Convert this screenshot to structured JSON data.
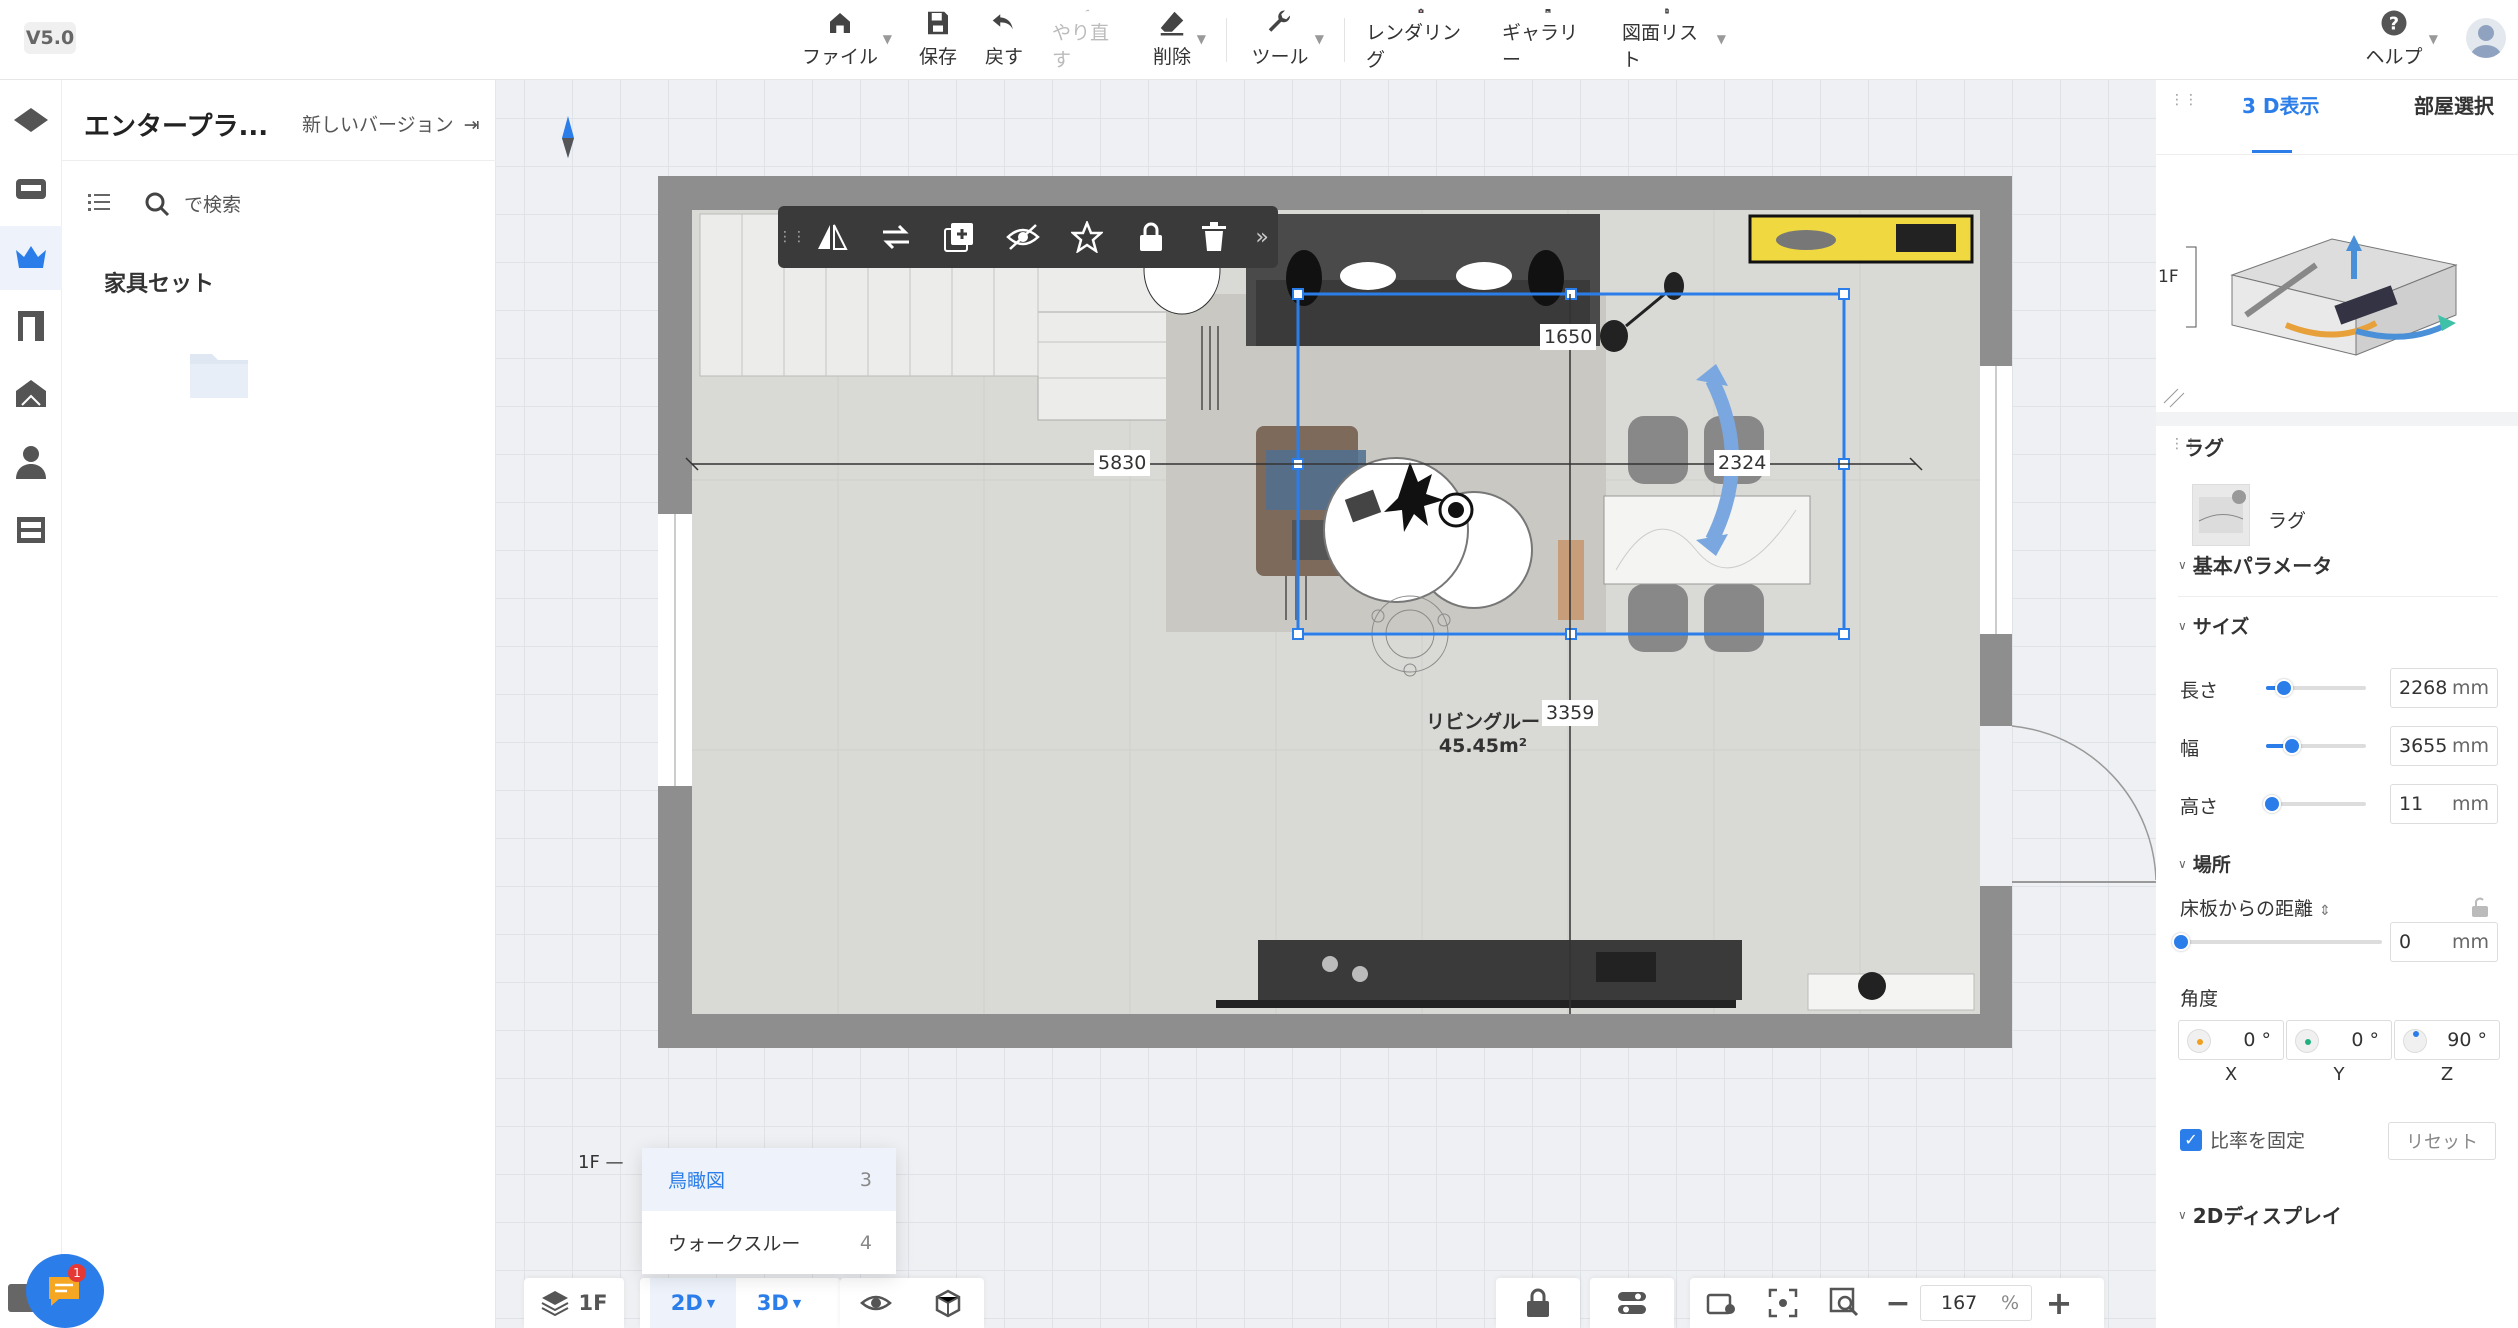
{
  "version": "V5.0",
  "toolbar": {
    "file": "ファイル",
    "save": "保存",
    "undo": "戻す",
    "redo": "やり直す",
    "delete": "削除",
    "tools": "ツール",
    "rendering": "レンダリング",
    "gallery": "ギャラリー",
    "drawing_list": "図面リスト",
    "help": "ヘルプ"
  },
  "left_panel": {
    "title": "エンタープラ...",
    "new_version": "新しいバージョン",
    "search_placeholder": "で検索",
    "category": "家具セット"
  },
  "canvas": {
    "room_name": "リビングルー",
    "room_area": "45.45m²",
    "dim_width": "5830",
    "dim_top": "1650",
    "dim_right": "2324",
    "dim_bottom": "3359",
    "floor_marker": "1F"
  },
  "view_menu": {
    "items": [
      {
        "label": "鳥瞰図",
        "count": "3"
      },
      {
        "label": "ウォークスルー",
        "count": "4"
      }
    ]
  },
  "bottom_left": {
    "floor": "1F",
    "mode_2d": "2D",
    "mode_3d": "3D"
  },
  "bottom_right": {
    "zoom": "167",
    "zoom_unit": "%"
  },
  "right_panel": {
    "tab_3d": "3 D表示",
    "tab_room": "部屋選択",
    "preview_floor": "1F",
    "object_title": "ラグ",
    "object_name": "ラグ",
    "section_basic": "基本パラメータ",
    "section_size": "サイズ",
    "length_label": "長さ",
    "length_value": "2268",
    "width_label": "幅",
    "width_value": "3655",
    "height_label": "高さ",
    "height_value": "11",
    "unit": "mm",
    "section_location": "場所",
    "floor_distance_label": "床板からの距離",
    "floor_distance_value": "0",
    "angle_label": "角度",
    "angle_x": "0",
    "angle_y": "0",
    "angle_z": "90",
    "degree": "°",
    "axis_x": "X",
    "axis_y": "Y",
    "axis_z": "Z",
    "lock_ratio": "比率を固定",
    "reset": "リセット",
    "section_2d": "2Dディスプレイ"
  },
  "chat_badge": "1",
  "colors": {
    "accent": "#2b7de9",
    "selection": "#2b7de9",
    "wall": "#8a8a8a"
  }
}
